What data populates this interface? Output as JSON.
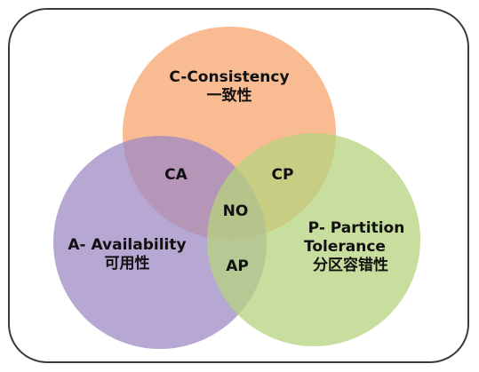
{
  "diagram": {
    "circles": {
      "consistency": {
        "title": "C-Consistency",
        "subtitle": "一致性",
        "color": "#f7a66e"
      },
      "availability": {
        "title": "A- Availability",
        "subtitle": "可用性",
        "color": "#9f8ac4"
      },
      "partition": {
        "title_line1": "P- Partition",
        "title_line2": "Tolerance",
        "subtitle": "分区容错性",
        "color": "#b6d37d"
      }
    },
    "intersections": {
      "ca": "CA",
      "cp": "CP",
      "ap": "AP",
      "center": "NO"
    },
    "frame_border_color": "#3a3a3a"
  }
}
